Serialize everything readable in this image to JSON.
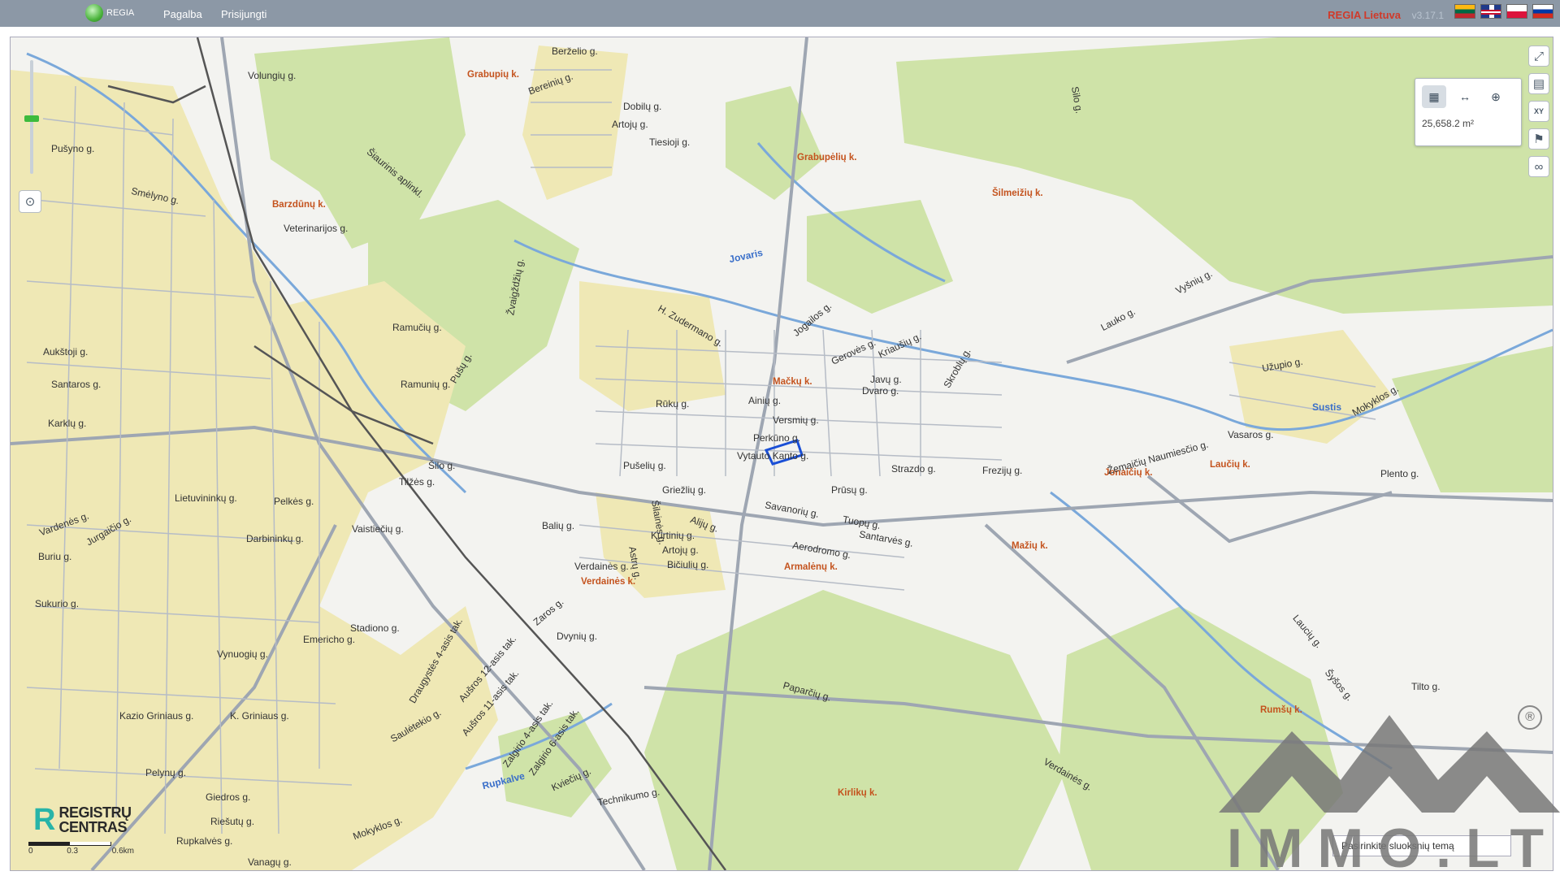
{
  "header": {
    "logo_text": "REGIA",
    "nav": [
      "Pagalba",
      "Prisijungti"
    ],
    "app_title": "REGIA Lietuva",
    "version": "v3.17.1"
  },
  "language_flags": [
    {
      "name": "lt-flag-icon"
    },
    {
      "name": "gb-flag-icon"
    },
    {
      "name": "pl-flag-icon"
    },
    {
      "name": "ru-flag-icon"
    }
  ],
  "map": {
    "colors": {
      "forest": "#cfe3a8",
      "urban": "#efe8b5",
      "water": "#7aa8da",
      "road": "#9ea6b2",
      "rail": "#555555",
      "selection": "#1a4fd6"
    },
    "labels": {
      "villages": [
        "Grabupių k.",
        "Grabupėlių k.",
        "Barzdūnų k.",
        "Šilmeižių k.",
        "Mačkų k.",
        "Jonaičių k.",
        "Laučių k.",
        "Mažių k.",
        "Armalėnų k.",
        "Verdainės k.",
        "Rumšų k.",
        "Kirlikų k."
      ],
      "water": [
        "Jovaris",
        "Sustis",
        "Rupkalve"
      ],
      "roads": [
        "Berželio g.",
        "Bereinių g.",
        "Dobilų g.",
        "Artojų g.",
        "Tiesioji g.",
        "Volungių g.",
        "Šiaurinis aplinkl.",
        "Pušyno g.",
        "Smėlyno g.",
        "Veterinarijos g.",
        "Žvaigždžių g.",
        "Ramučių g.",
        "Ramunių g.",
        "Aukštoji g.",
        "Santaros g.",
        "Karklų g.",
        "Šilo g.",
        "Tilžės g.",
        "Vaistiečių g.",
        "Lietuvininkų g.",
        "Darbininkų g.",
        "Pelkės g.",
        "Vardenės g.",
        "Jurgaičio g.",
        "Buriu g.",
        "Sukurio g.",
        "Emericho g.",
        "Stadiono g.",
        "Vynuogių g.",
        "Kazio Griniaus g.",
        "K. Griniaus g.",
        "Pelynų g.",
        "Giedros g.",
        "Riešutų g.",
        "Rupkalvės g.",
        "Vanagų g.",
        "Mokyklos g.",
        "Saulėtekio g.",
        "Technikumo g.",
        "Draugystės 4-asis tak.",
        "Aušros 12-asis tak.",
        "Aušros 11-asis tak.",
        "Zalgirio 4-asis tak.",
        "Zalgirio 6-asis tak.",
        "Kviečių g.",
        "Dvynių g.",
        "Zaros g.",
        "Verdainės g.",
        "Artojų g.",
        "Bičiulių g.",
        "Kurtinių g.",
        "Astrų g.",
        "Balių g.",
        "Alijų g.",
        "Griežlių g.",
        "Savanorių g.",
        "Tuopų g.",
        "Santarvės g.",
        "Aerodromo g.",
        "Prūsų g.",
        "Strazdo g.",
        "Frezijų g.",
        "Vytauto Kanto g.",
        "Perkūno g.",
        "Versmių g.",
        "Ainių g.",
        "Dvaro g.",
        "Javų g.",
        "Gerovės g.",
        "Kriaušių g.",
        "Jogailos g.",
        "Skroblų g.",
        "Žemaičių Naumiesčio g.",
        "Lauko g.",
        "Vyšnių g.",
        "Vasaros g.",
        "Užupio g.",
        "Mokyklos g.",
        "Plento g.",
        "Tilto g.",
        "Paparčių g.",
        "Verdainės g.",
        "Laucių g.",
        "Šyšos g.",
        "Silo g.",
        "Pušų g.",
        "Rūkų g.",
        "H. Zudermano g.",
        "Pušelių g.",
        "Šilainės g."
      ]
    },
    "scale": {
      "ticks": [
        "0",
        "0.3",
        "0.6km"
      ]
    }
  },
  "measure_panel": {
    "tools": [
      "area-measure-icon",
      "distance-measure-icon",
      "globe-icon"
    ],
    "area_value": "25,658.2 m²"
  },
  "right_tools": [
    "fullscreen-icon",
    "map-extent-icon",
    "coordinates-icon",
    "flag-icon",
    "link-icon"
  ],
  "right_tools_text": {
    "coordinates": "XY"
  },
  "brand": {
    "registru_line1": "REGISTRŲ",
    "registru_line2": "CENTRAS"
  },
  "theme_select": {
    "placeholder": "Pasirinkite sluoksnių temą"
  },
  "watermark": {
    "text": "IMMO.LT",
    "reg": "®"
  }
}
